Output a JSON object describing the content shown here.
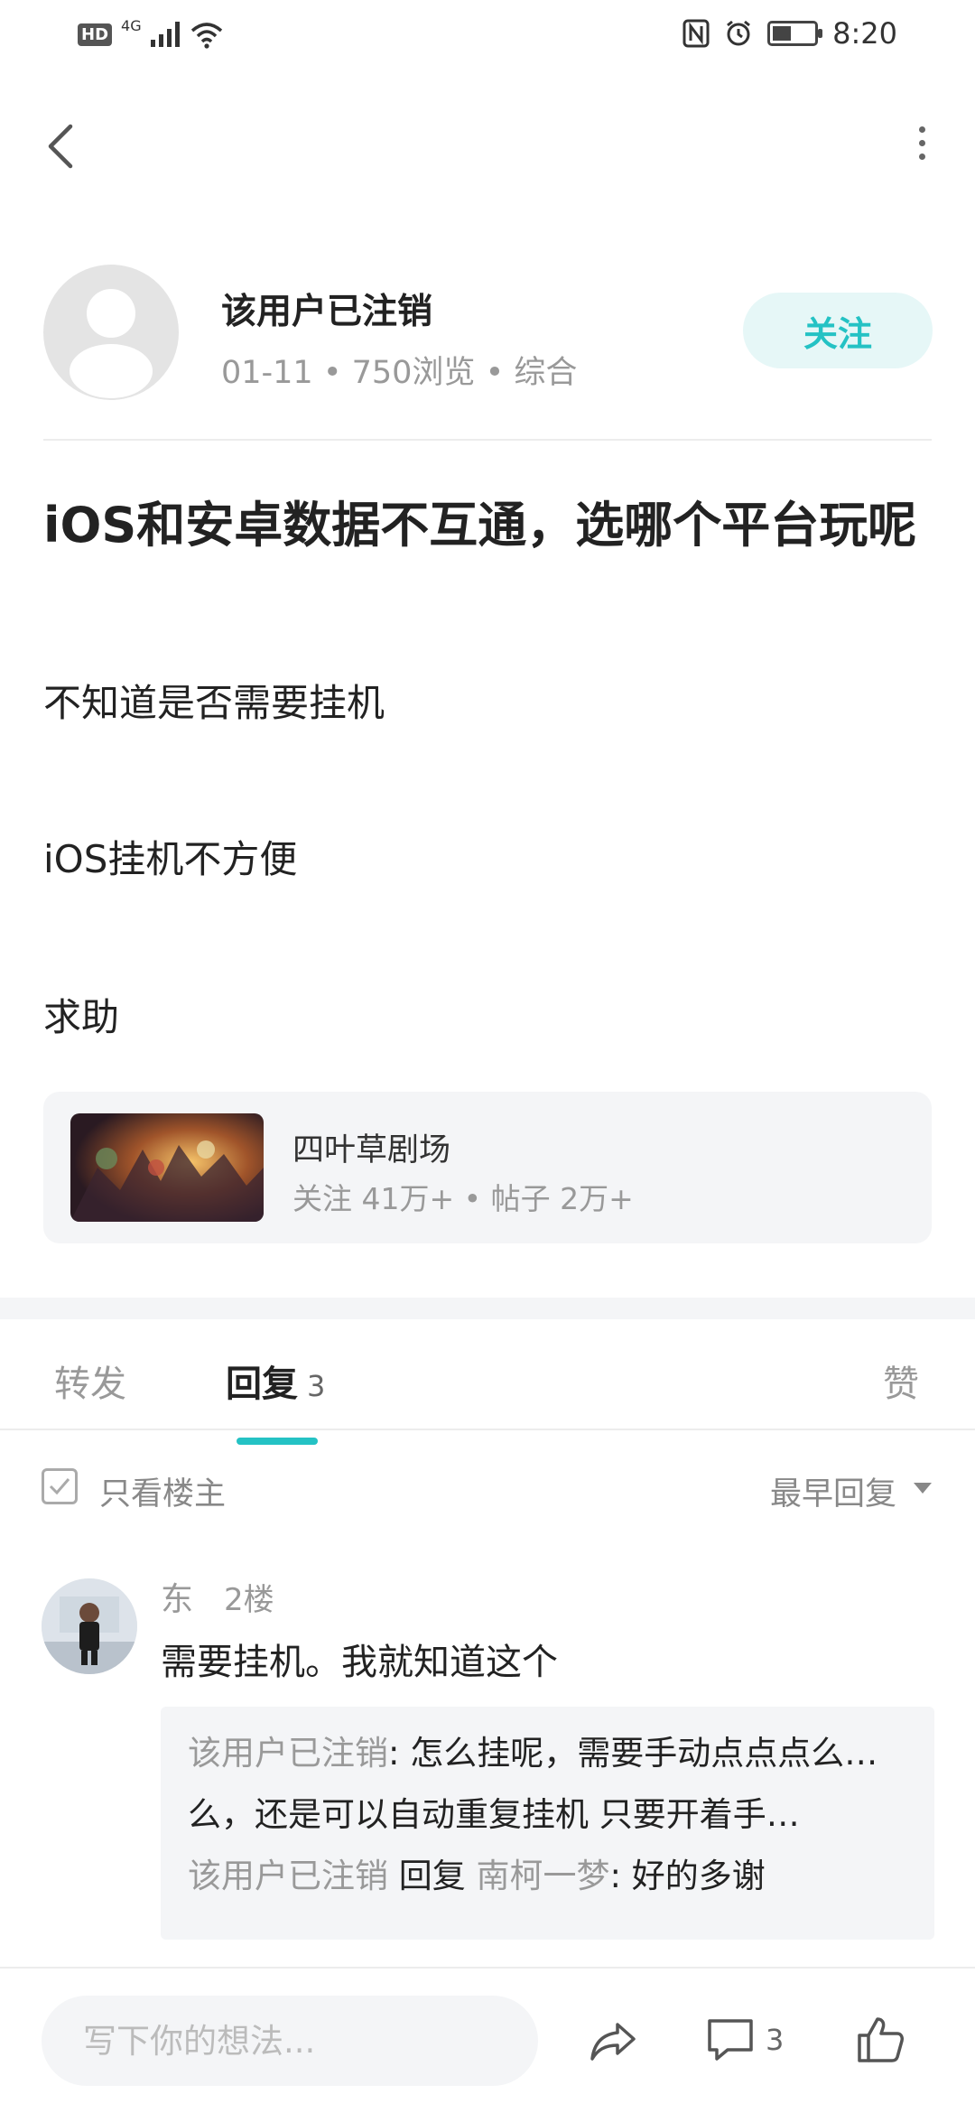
{
  "status_bar": {
    "hd": "HD",
    "network": "4G",
    "time": "8:20"
  },
  "author": {
    "name": "该用户已注销",
    "date": "01-11",
    "views": "750浏览",
    "category": "综合",
    "follow_label": "关注"
  },
  "post": {
    "title": "iOS和安卓数据不互通，选哪个平台玩呢",
    "body": [
      "不知道是否需要挂机",
      "iOS挂机不方便",
      "求助"
    ]
  },
  "community": {
    "name": "四叶草剧场",
    "followers": "关注 41万+",
    "posts": "帖子 2万+"
  },
  "tabs": {
    "forward": "转发",
    "reply": "回复",
    "reply_count": "3",
    "like": "赞"
  },
  "filter": {
    "only_owner": "只看楼主",
    "sort": "最早回复"
  },
  "reply": {
    "user": "东",
    "floor": "2楼",
    "text": "需要挂机。我就知道这个",
    "sub_replies": [
      {
        "user": "该用户已注销",
        "text": ": 怎么挂呢，需要手动点点点么，还是可以自动重复挂机 只要开着手..."
      },
      {
        "user": "该用户已注销",
        "connector": "回复",
        "target": "南柯一梦",
        "text": ": 好的多谢"
      }
    ]
  },
  "bottom_bar": {
    "input_placeholder": "写下你的想法...",
    "comment_count": "3"
  },
  "colors": {
    "accent": "#24c2c4",
    "follow_bg": "#e6f7f7",
    "muted": "#999999",
    "card_bg": "#f4f5f7"
  },
  "icons": [
    "back-icon",
    "more-icon",
    "share-icon",
    "comment-icon",
    "like-icon",
    "nfc-icon",
    "alarm-icon",
    "wifi-icon",
    "signal-icon",
    "battery-icon"
  ]
}
